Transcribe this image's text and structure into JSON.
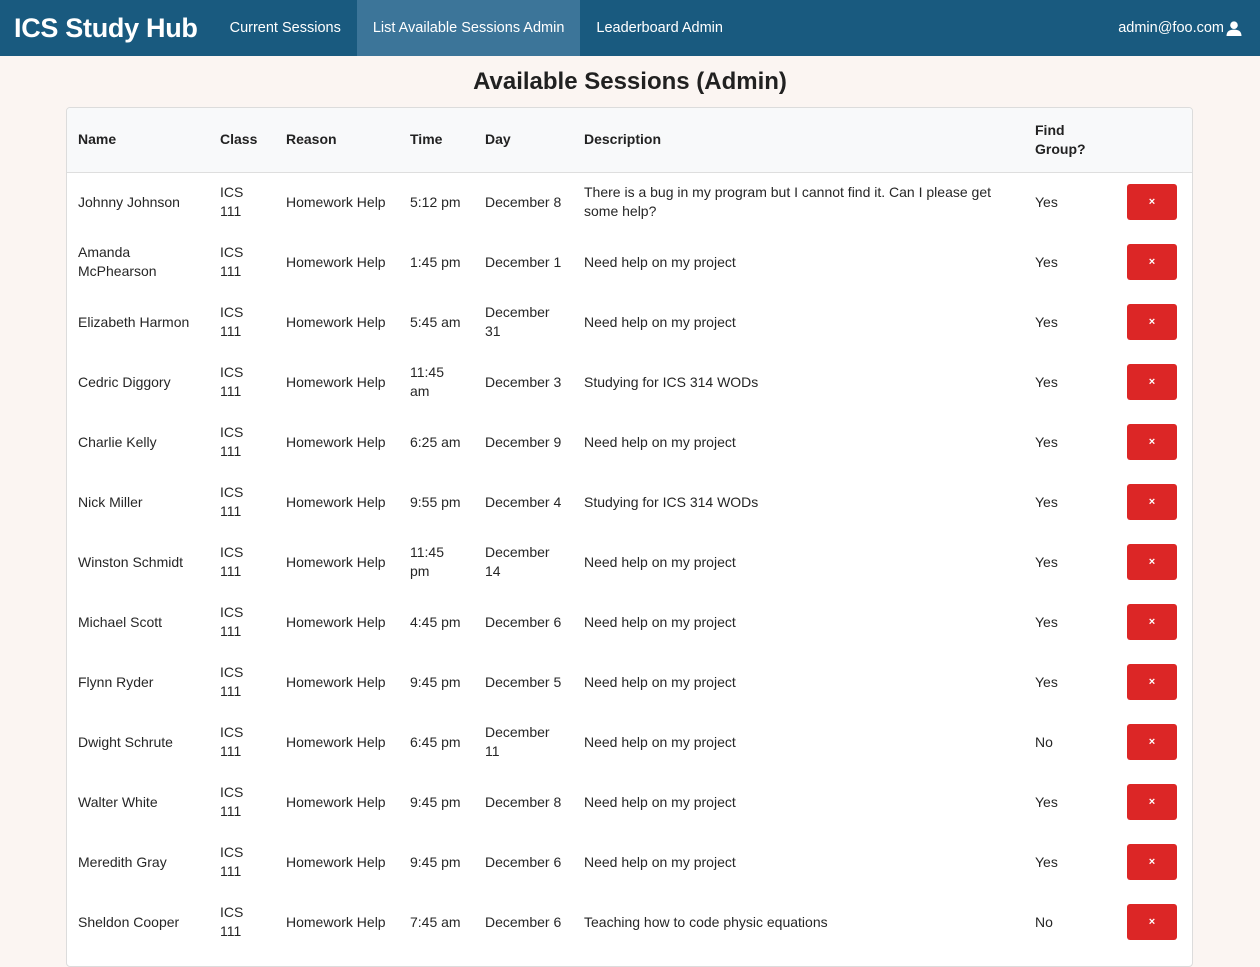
{
  "app": {
    "brand": "ICS Study Hub",
    "nav": [
      {
        "label": "Current Sessions",
        "active": false
      },
      {
        "label": "List Available Sessions Admin",
        "active": true
      },
      {
        "label": "Leaderboard Admin",
        "active": false
      }
    ],
    "user": "admin@foo.com",
    "user_icon": "user-icon"
  },
  "page": {
    "title": "Available Sessions (Admin)"
  },
  "table": {
    "headers": [
      "Name",
      "Class",
      "Reason",
      "Time",
      "Day",
      "Description",
      "Find Group?",
      ""
    ],
    "delete_label": "×",
    "delete_color": "#dc2626",
    "rows": [
      {
        "name": "Johnny Johnson",
        "class": "ICS 111",
        "reason": "Homework Help",
        "time": "5:12 pm",
        "day": "December 8",
        "description": "There is a bug in my program but I cannot find it. Can I please get some help?",
        "find_group": "Yes"
      },
      {
        "name": "Amanda McPhearson",
        "class": "ICS 111",
        "reason": "Homework Help",
        "time": "1:45 pm",
        "day": "December 1",
        "description": "Need help on my project",
        "find_group": "Yes"
      },
      {
        "name": "Elizabeth Harmon",
        "class": "ICS 111",
        "reason": "Homework Help",
        "time": "5:45 am",
        "day": "December 31",
        "description": "Need help on my project",
        "find_group": "Yes"
      },
      {
        "name": "Cedric Diggory",
        "class": "ICS 111",
        "reason": "Homework Help",
        "time": "11:45 am",
        "day": "December 3",
        "description": "Studying for ICS 314 WODs",
        "find_group": "Yes"
      },
      {
        "name": "Charlie Kelly",
        "class": "ICS 111",
        "reason": "Homework Help",
        "time": "6:25 am",
        "day": "December 9",
        "description": "Need help on my project",
        "find_group": "Yes"
      },
      {
        "name": "Nick Miller",
        "class": "ICS 111",
        "reason": "Homework Help",
        "time": "9:55 pm",
        "day": "December 4",
        "description": "Studying for ICS 314 WODs",
        "find_group": "Yes"
      },
      {
        "name": "Winston Schmidt",
        "class": "ICS 111",
        "reason": "Homework Help",
        "time": "11:45 pm",
        "day": "December 14",
        "description": "Need help on my project",
        "find_group": "Yes"
      },
      {
        "name": "Michael Scott",
        "class": "ICS 111",
        "reason": "Homework Help",
        "time": "4:45 pm",
        "day": "December 6",
        "description": "Need help on my project",
        "find_group": "Yes"
      },
      {
        "name": "Flynn Ryder",
        "class": "ICS 111",
        "reason": "Homework Help",
        "time": "9:45 pm",
        "day": "December 5",
        "description": "Need help on my project",
        "find_group": "Yes"
      },
      {
        "name": "Dwight Schrute",
        "class": "ICS 111",
        "reason": "Homework Help",
        "time": "6:45 pm",
        "day": "December 11",
        "description": "Need help on my project",
        "find_group": "No"
      },
      {
        "name": "Walter White",
        "class": "ICS 111",
        "reason": "Homework Help",
        "time": "9:45 pm",
        "day": "December 8",
        "description": "Need help on my project",
        "find_group": "Yes"
      },
      {
        "name": "Meredith Gray",
        "class": "ICS 111",
        "reason": "Homework Help",
        "time": "9:45 pm",
        "day": "December 6",
        "description": "Need help on my project",
        "find_group": "Yes"
      },
      {
        "name": "Sheldon Cooper",
        "class": "ICS 111",
        "reason": "Homework Help",
        "time": "7:45 am",
        "day": "December 6",
        "description": "Teaching how to code physic equations",
        "find_group": "No"
      }
    ]
  }
}
